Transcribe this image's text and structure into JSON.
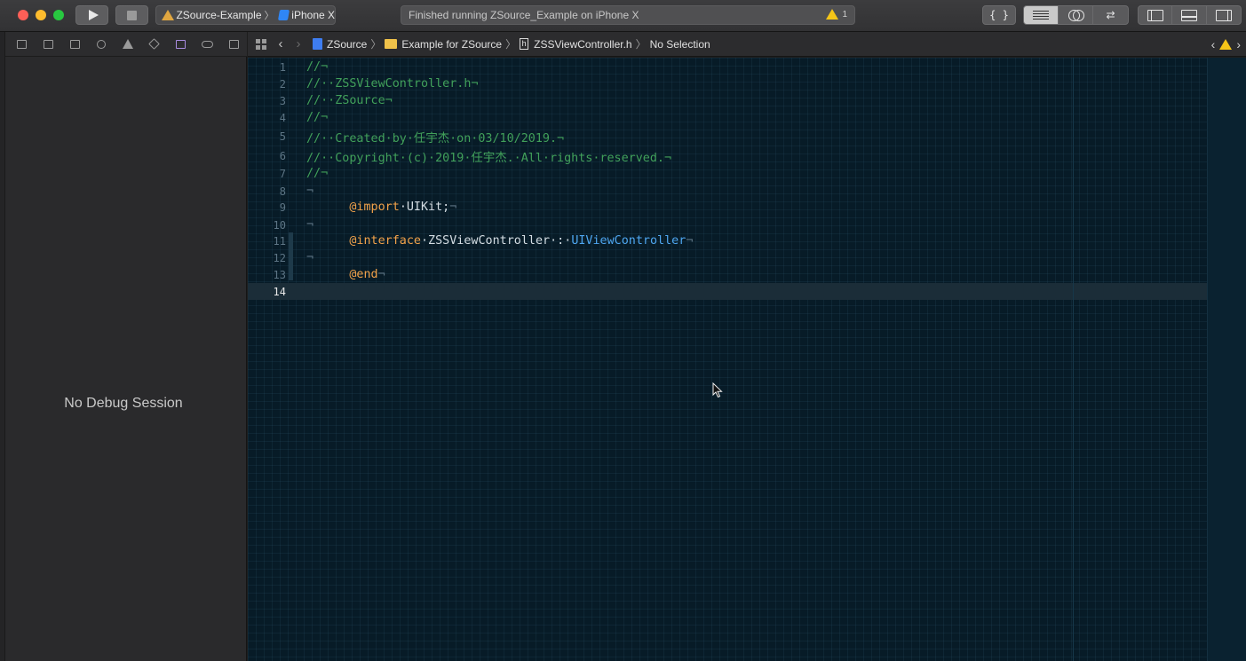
{
  "toolbar": {
    "scheme_name": "ZSource-Example",
    "device_name": "iPhone X",
    "activity_text": "Finished running ZSource_Example on iPhone X",
    "warning_count": "1",
    "library_label": "{ }"
  },
  "navigator": {
    "tabs": [
      "folder-icon",
      "source-control-icon",
      "symbol-icon",
      "search-icon",
      "issue-icon",
      "test-icon",
      "debug-icon",
      "breakpoint-icon",
      "report-icon"
    ],
    "placeholder": "No Debug Session"
  },
  "jumpbar": {
    "project": "ZSource",
    "group": "Example for ZSource",
    "file": "ZSSViewController.h",
    "selection": "No Selection",
    "file_badge": "h"
  },
  "editor": {
    "current_line": 14,
    "lines": [
      {
        "n": "1"
      },
      {
        "n": "2"
      },
      {
        "n": "3"
      },
      {
        "n": "4"
      },
      {
        "n": "5"
      },
      {
        "n": "6"
      },
      {
        "n": "7"
      },
      {
        "n": "8"
      },
      {
        "n": "9"
      },
      {
        "n": "10"
      },
      {
        "n": "11"
      },
      {
        "n": "12"
      },
      {
        "n": "13"
      },
      {
        "n": "14"
      }
    ],
    "code": {
      "l1": "//¬",
      "l2": "//··ZSSViewController.h¬",
      "l3": "//··ZSource¬",
      "l4": "//¬",
      "l5": "//··Created·by·任宇杰·on·03/10/2019.¬",
      "l6": "//··Copyright·(c)·2019·任宇杰.·All·rights·reserved.¬",
      "l7": "//¬",
      "l8": "¬",
      "l9_kw": "@import",
      "l9_rest": "·UIKit;",
      "l10": "¬",
      "l11_kw": "@interface",
      "l11_name": "·ZSSViewController·:·",
      "l11_type": "UIViewController",
      "l12": "¬",
      "l13_kw": "@end",
      "eol": "¬"
    }
  },
  "colors": {
    "comment": "#41a05a",
    "keyword": "#f2a24a",
    "type": "#4ea6f0",
    "background": "#071b27"
  }
}
